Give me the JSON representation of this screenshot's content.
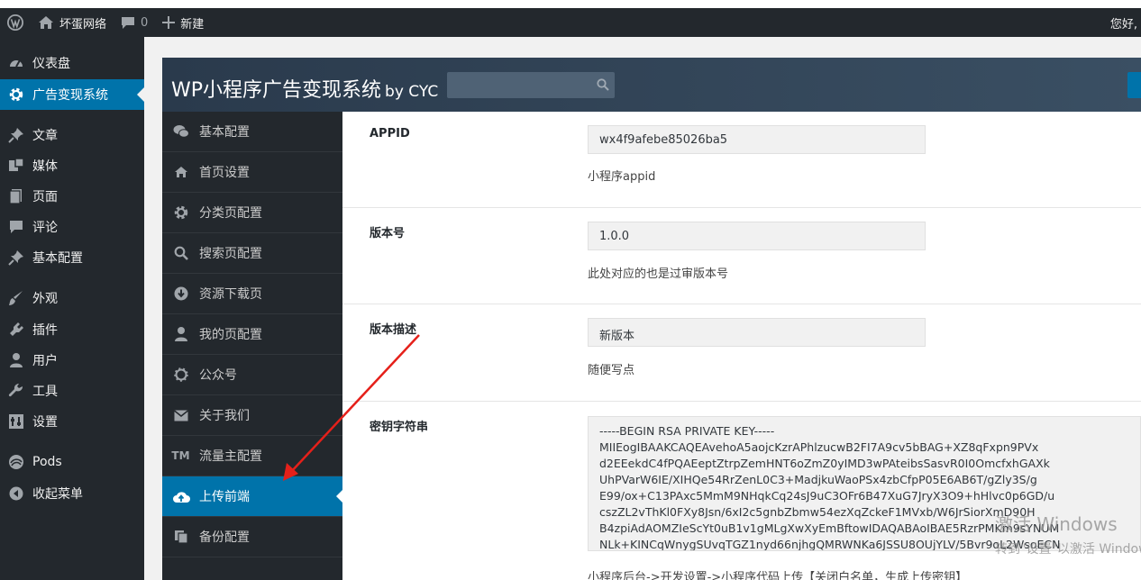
{
  "admin_bar": {
    "site_name": "坏蛋网络",
    "comments_count": "0",
    "new_label": "新建",
    "greeting": "您好,"
  },
  "admin_menu": [
    {
      "label": "仪表盘",
      "icon": "dashboard-icon"
    },
    {
      "label": "广告变现系统",
      "icon": "gear-icon",
      "current": true
    },
    {
      "label": "文章",
      "icon": "pin-icon"
    },
    {
      "label": "媒体",
      "icon": "media-icon"
    },
    {
      "label": "页面",
      "icon": "page-icon"
    },
    {
      "label": "评论",
      "icon": "comment-icon"
    },
    {
      "label": "基本配置",
      "icon": "pin-icon"
    },
    {
      "label": "外观",
      "icon": "brush-icon"
    },
    {
      "label": "插件",
      "icon": "plugin-icon"
    },
    {
      "label": "用户",
      "icon": "user-icon"
    },
    {
      "label": "工具",
      "icon": "wrench-icon"
    },
    {
      "label": "设置",
      "icon": "settings-icon"
    },
    {
      "label": "Pods",
      "icon": "pods-icon"
    },
    {
      "label": "收起菜单",
      "icon": "collapse-icon"
    }
  ],
  "panel": {
    "title": "WP小程序广告变现系统",
    "by": "by CYC"
  },
  "tabs": [
    {
      "label": "基本配置",
      "icon": "wechat-icon"
    },
    {
      "label": "首页设置",
      "icon": "home-icon"
    },
    {
      "label": "分类页配置",
      "icon": "gear-icon"
    },
    {
      "label": "搜索页配置",
      "icon": "search-icon"
    },
    {
      "label": "资源下载页",
      "icon": "download-icon"
    },
    {
      "label": "我的页配置",
      "icon": "user-icon"
    },
    {
      "label": "公众号",
      "icon": "gear-outline-icon"
    },
    {
      "label": "关于我们",
      "icon": "mail-icon"
    },
    {
      "label": "流量主配置",
      "icon": "tm-icon",
      "glyph": "TM"
    },
    {
      "label": "上传前端",
      "icon": "cloud-upload-icon",
      "active": true
    },
    {
      "label": "备份配置",
      "icon": "copy-icon"
    }
  ],
  "fields": {
    "appid": {
      "label": "APPID",
      "value": "wx4f9afebe85026ba5",
      "desc": "小程序appid"
    },
    "version": {
      "label": "版本号",
      "value": "1.0.0",
      "desc": "此处对应的也是过审版本号"
    },
    "version_desc": {
      "label": "版本描述",
      "value": "新版本",
      "desc": "随便写点"
    },
    "key": {
      "label": "密钥字符串",
      "value": "-----BEGIN RSA PRIVATE KEY-----\nMIIEogIBAAKCAQEAvehoA5aojcKzrAPhlzucwB2FI7A9cv5bBAG+XZ8qFxpn9PVx\nd2EEekdC4fPQAEeptZtrpZemHNT6oZmZ0yIMD3wPAteibsSasvR0I0OmcfxhGAXk\nUhPVarW6IE/XIHQe54RrZenL0C3+MadjkuWaoPSx4zbCfpP05E6AB6T/gZly3S/g\nE99/ox+C13PAxc5MmM9NHqkCq24sJ9uC3OFr6B47XuG7JryX3O9+hHlvc0p6GD/u\ncszZL2vThKl0FXy8Jsn/6xI2c5gnbZbmw54ezXqZckeF1MVxb/W6JrSiorXmD90H\nB4zpiAdAOMZIeScYt0uB1v1gMLgXwXyEmBftowIDAQABAoIBAE5RzrPMKm9sYNUM\nNLk+KINCqWnygSUvqTGZ1nyd66njhgQMRWNKa6JSSU8OUjYLV/5Bvr9oL2WsoECN",
      "desc": "小程序后台->开发设置->小程序代码上传【关闭白名单，生成上传密钥】"
    }
  },
  "watermark": {
    "line1": "激活 Windows",
    "line2": "转到\"设置\"以激活 Windows。"
  },
  "colors": {
    "accent": "#0073aa",
    "sidebar": "#23282d",
    "header": "#2e3f52",
    "annotation": "#e5201a"
  }
}
